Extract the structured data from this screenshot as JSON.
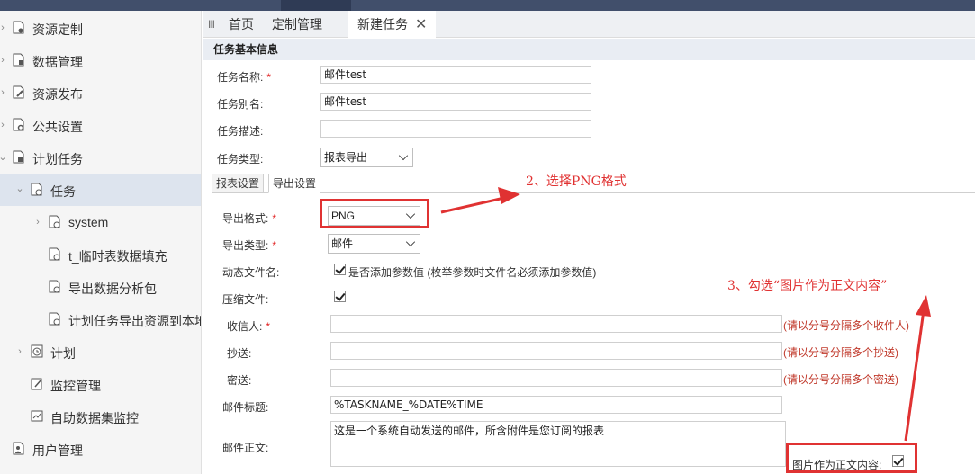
{
  "sidebar": {
    "items": [
      {
        "label": "资源定制",
        "icon": "document-settings-icon"
      },
      {
        "label": "数据管理",
        "icon": "document-data-icon"
      },
      {
        "label": "资源发布",
        "icon": "document-edit-icon"
      },
      {
        "label": "公共设置",
        "icon": "document-gear-icon"
      },
      {
        "label": "计划任务",
        "icon": "document-schedule-icon"
      },
      {
        "label": "任务",
        "icon": "task-icon"
      },
      {
        "label": "system",
        "icon": "task-icon"
      },
      {
        "label": "t_临时表数据填充",
        "icon": "task-icon"
      },
      {
        "label": "导出数据分析包",
        "icon": "task-icon"
      },
      {
        "label": "计划任务导出资源到本地",
        "icon": "task-icon"
      },
      {
        "label": "计划",
        "icon": "clock-icon"
      },
      {
        "label": "监控管理",
        "icon": "monitor-edit-icon"
      },
      {
        "label": "自助数据集监控",
        "icon": "chart-monitor-icon"
      },
      {
        "label": "用户管理",
        "icon": "users-icon"
      }
    ]
  },
  "tabs": {
    "menu_glyph": "III",
    "items": [
      {
        "label": "首页"
      },
      {
        "label": "定制管理"
      },
      {
        "label": "新建任务"
      }
    ],
    "close_glyph": "✕"
  },
  "form": {
    "section_title": "任务基本信息",
    "task_name_label": "任务名称:",
    "task_name_value": "邮件test",
    "task_alias_label": "任务别名:",
    "task_alias_value": "邮件test",
    "task_desc_label": "任务描述:",
    "task_desc_value": "",
    "task_type_label": "任务类型:",
    "task_type_value": "报表导出",
    "required_mark": "*"
  },
  "subtabs": {
    "report_settings": "报表设置",
    "export_settings": "导出设置"
  },
  "export": {
    "format_label": "导出格式:",
    "format_value": "PNG",
    "type_label": "导出类型:",
    "type_value": "邮件",
    "dynamic_filename_label": "动态文件名:",
    "dynamic_filename_text": "是否添加参数值 (枚举参数时文件名必须添加参数值)",
    "dynamic_filename_checked": true,
    "compress_label": "压缩文件:",
    "compress_checked": true,
    "recipients_label": "收信人:",
    "recipients_value": "",
    "recipients_hint": "(请以分号分隔多个收件人)",
    "cc_label": "抄送:",
    "cc_value": "",
    "cc_hint": "(请以分号分隔多个抄送)",
    "bcc_label": "密送:",
    "bcc_value": "",
    "bcc_hint": "(请以分号分隔多个密送)",
    "subject_label": "邮件标题:",
    "subject_value": "%TASKNAME_%DATE%TIME",
    "body_label": "邮件正文:",
    "body_value": "这是一个系统自动发送的邮件，所含附件是您订阅的报表",
    "image_as_body_label": "图片作为正文内容:",
    "image_as_body_checked": true
  },
  "annotations": {
    "step2": "2、选择PNG格式",
    "step3": "3、勾选“图片作为正文内容”",
    "color": "#e03232"
  },
  "colors": {
    "topbar": "#414f6b",
    "sidebar_bg": "#f5f5f5",
    "selected_bg": "#dde4ee",
    "section_bg": "#e9edf3",
    "hint_red": "#c0392b"
  }
}
